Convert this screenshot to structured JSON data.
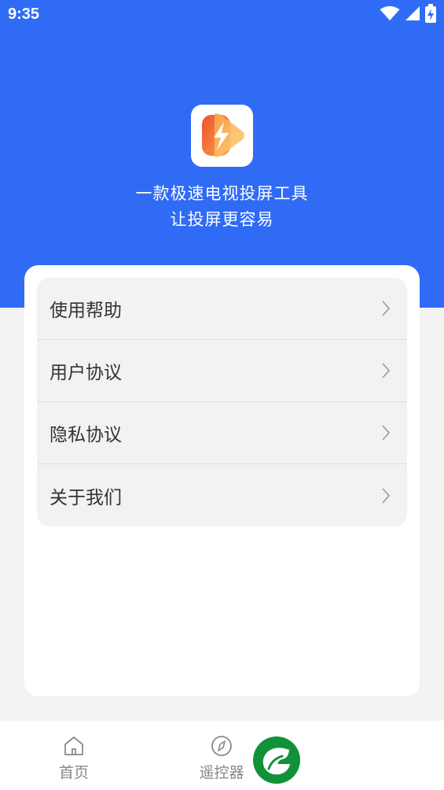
{
  "status_bar": {
    "time": "9:35",
    "icons": [
      "wifi-icon",
      "signal-icon",
      "battery-charging-icon"
    ]
  },
  "header": {
    "logo_icon": "lightning-play-logo",
    "tagline_line1": "一款极速电视投屏工具",
    "tagline_line2": "让投屏更容易"
  },
  "menu": {
    "items": [
      {
        "label": "使用帮助"
      },
      {
        "label": "用户协议"
      },
      {
        "label": "隐私协议"
      },
      {
        "label": "关于我们"
      }
    ]
  },
  "tab_bar": {
    "tabs": [
      {
        "label": "首页",
        "icon": "home-icon"
      },
      {
        "label": "遥控器",
        "icon": "compass-icon"
      }
    ]
  },
  "colors": {
    "header_blue": "#2f6bf5",
    "page_background": "#f3f3f3",
    "menu_background": "#f2f2f2",
    "tab_inactive": "#888888"
  }
}
